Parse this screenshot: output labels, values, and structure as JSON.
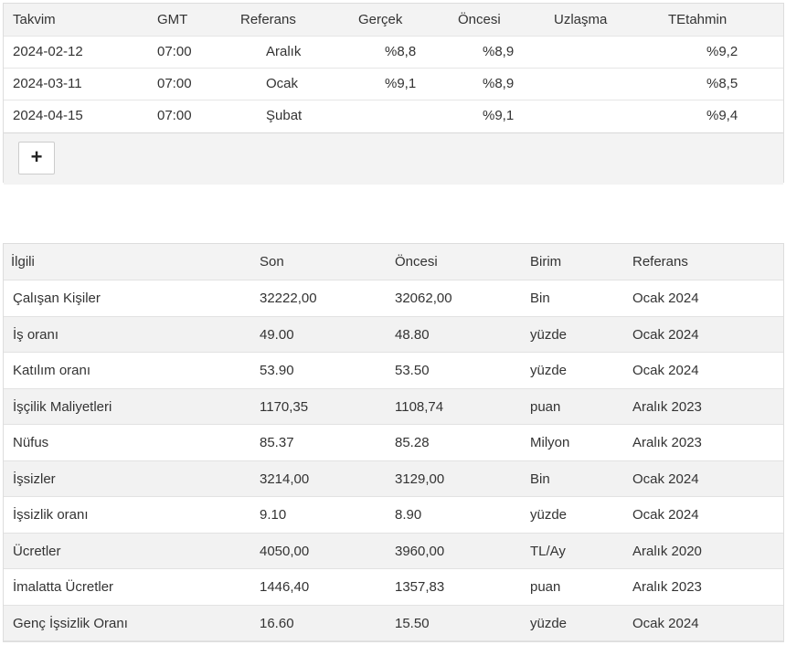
{
  "calendar": {
    "headers": [
      "Takvim",
      "GMT",
      "Referans",
      "Gerçek",
      "Öncesi",
      "Uzlaşma",
      "TEtahmin"
    ],
    "rows": [
      {
        "date": "2024-02-12",
        "gmt": "07:00",
        "reference": "Aralık",
        "actual": "%8,8",
        "previous": "%8,9",
        "consensus": "",
        "forecast": "%9,2"
      },
      {
        "date": "2024-03-11",
        "gmt": "07:00",
        "reference": "Ocak",
        "actual": "%9,1",
        "previous": "%8,9",
        "consensus": "",
        "forecast": "%8,5"
      },
      {
        "date": "2024-04-15",
        "gmt": "07:00",
        "reference": "Şubat",
        "actual": "",
        "previous": "%9,1",
        "consensus": "",
        "forecast": "%9,4"
      }
    ],
    "add_button_label": "+"
  },
  "related": {
    "headers": [
      "İlgili",
      "Son",
      "Öncesi",
      "Birim",
      "Referans"
    ],
    "rows": [
      {
        "name": "Çalışan Kişiler",
        "last": "32222,00",
        "previous": "32062,00",
        "unit": "Bin",
        "reference": "Ocak 2024"
      },
      {
        "name": "İş oranı",
        "last": "49.00",
        "previous": "48.80",
        "unit": "yüzde",
        "reference": "Ocak 2024"
      },
      {
        "name": "Katılım oranı",
        "last": "53.90",
        "previous": "53.50",
        "unit": "yüzde",
        "reference": "Ocak 2024"
      },
      {
        "name": "İşçilik Maliyetleri",
        "last": "1170,35",
        "previous": "1108,74",
        "unit": "puan",
        "reference": "Aralık 2023"
      },
      {
        "name": "Nüfus",
        "last": "85.37",
        "previous": "85.28",
        "unit": "Milyon",
        "reference": "Aralık 2023"
      },
      {
        "name": "İşsizler",
        "last": "3214,00",
        "previous": "3129,00",
        "unit": "Bin",
        "reference": "Ocak 2024"
      },
      {
        "name": "İşsizlik oranı",
        "last": "9.10",
        "previous": "8.90",
        "unit": "yüzde",
        "reference": "Ocak 2024"
      },
      {
        "name": "Ücretler",
        "last": "4050,00",
        "previous": "3960,00",
        "unit": "TL/Ay",
        "reference": "Aralık 2020"
      },
      {
        "name": "İmalatta Ücretler",
        "last": "1446,40",
        "previous": "1357,83",
        "unit": "puan",
        "reference": "Aralık 2023"
      },
      {
        "name": "Genç İşsizlik Oranı",
        "last": "16.60",
        "previous": "15.50",
        "unit": "yüzde",
        "reference": "Ocak 2024"
      }
    ]
  }
}
